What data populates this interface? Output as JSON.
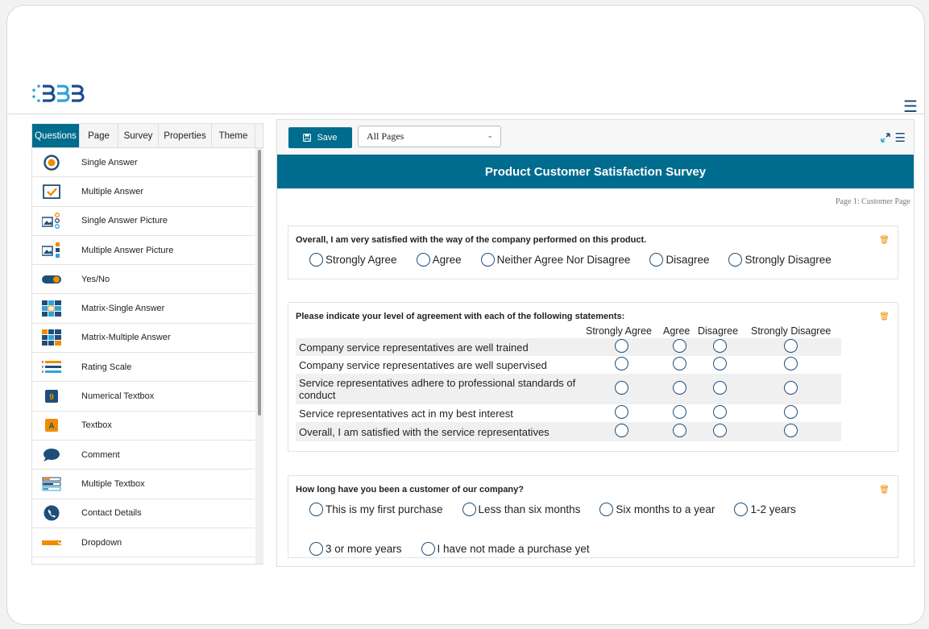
{
  "header": {
    "logo_icon": "bdb-logo-icon",
    "menu_icon": "hamburger-icon",
    "brand_color": "#006c8e"
  },
  "left_panel": {
    "tabs": [
      {
        "label": "Questions",
        "active": true
      },
      {
        "label": "Page",
        "active": false
      },
      {
        "label": "Survey",
        "active": false
      },
      {
        "label": "Properties",
        "active": false
      },
      {
        "label": "Theme",
        "active": false
      }
    ],
    "question_types": [
      {
        "label": "Single Answer",
        "icon": "radio-button-icon"
      },
      {
        "label": "Multiple Answer",
        "icon": "checkbox-icon"
      },
      {
        "label": "Single Answer Picture",
        "icon": "picture-radio-icon"
      },
      {
        "label": "Multiple Answer Picture",
        "icon": "picture-checkbox-icon"
      },
      {
        "label": "Yes/No",
        "icon": "toggle-icon"
      },
      {
        "label": "Matrix-Single Answer",
        "icon": "matrix-single-icon"
      },
      {
        "label": "Matrix-Multiple Answer",
        "icon": "matrix-multiple-icon"
      },
      {
        "label": "Rating Scale",
        "icon": "rating-scale-icon"
      },
      {
        "label": "Numerical Textbox",
        "icon": "numeric-textbox-icon"
      },
      {
        "label": "Textbox",
        "icon": "textbox-icon"
      },
      {
        "label": "Comment",
        "icon": "comment-bubble-icon"
      },
      {
        "label": "Multiple Textbox",
        "icon": "multiple-textbox-icon"
      },
      {
        "label": "Contact Details",
        "icon": "phone-icon"
      },
      {
        "label": "Dropdown",
        "icon": "dropdown-icon"
      }
    ]
  },
  "toolbar": {
    "save_label": "Save",
    "save_icon": "floppy-disk-icon",
    "page_select_value": "All Pages",
    "expand_icon": "expand-arrows-icon",
    "menu_icon": "hamburger-icon"
  },
  "survey": {
    "title": "Product Customer Satisfaction Survey",
    "page_indicator": "Page 1:  Customer Page",
    "q1": {
      "title": "Overall, I am very satisfied with the way of the company performed on this product.",
      "options": [
        "Strongly Agree",
        "Agree",
        "Neither Agree Nor Disagree",
        "Disagree",
        "Strongly Disagree"
      ]
    },
    "q2": {
      "title": "Please indicate your level of agreement with each of the following statements:",
      "columns": [
        "Strongly Agree",
        "Agree",
        "Disagree",
        "Strongly Disagree"
      ],
      "rows": [
        "Company service representatives are well trained",
        "Company service representatives are well supervised",
        "Service representatives adhere to professional standards of conduct",
        "Service representatives act in my best interest",
        "Overall, I am satisfied with the service representatives"
      ]
    },
    "q3": {
      "title": "How long have you been a customer of our company?",
      "options": [
        "This is my first purchase",
        "Less than six months",
        "Six months to a year",
        "1-2 years",
        "3 or more years",
        "I have not made a purchase yet"
      ]
    },
    "delete_icon": "trash-icon",
    "accent_color": "#f08c00"
  }
}
